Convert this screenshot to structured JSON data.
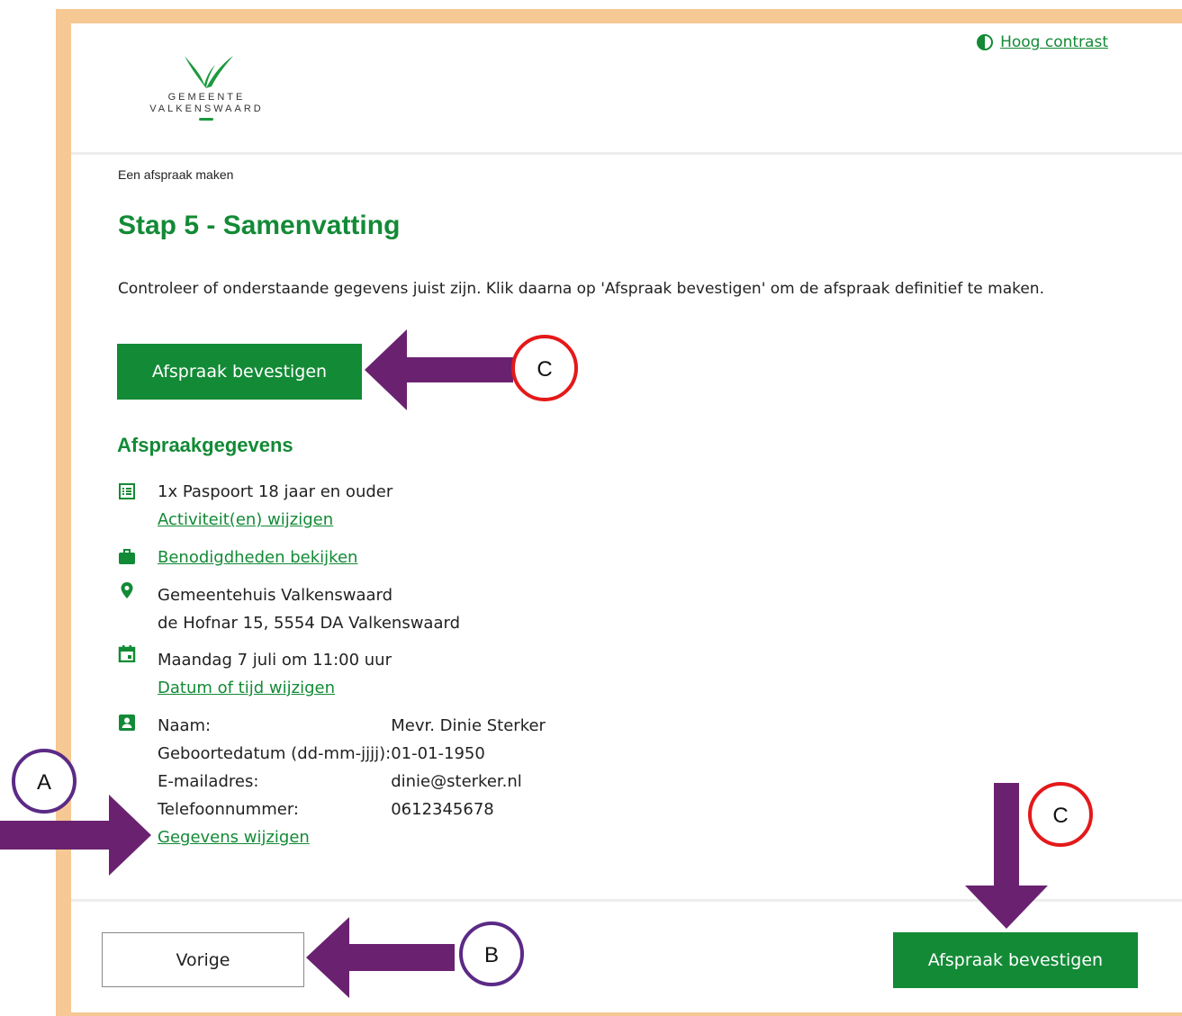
{
  "header": {
    "logo_line1": "GEMEENTE",
    "logo_line2": "VALKENSWAARD",
    "contrast_link": "Hoog contrast"
  },
  "breadcrumb": "Een afspraak maken",
  "title": "Stap 5 - Samenvatting",
  "intro": "Controleer of onderstaande gegevens juist zijn. Klik daarna op 'Afspraak bevestigen' om de afspraak definitief te maken.",
  "confirm_label": "Afspraak bevestigen",
  "section_title": "Afspraakgegevens",
  "activity": {
    "text": "1x Paspoort 18 jaar en ouder",
    "link": "Activiteit(en) wijzigen"
  },
  "requirements_link": "Benodigdheden bekijken",
  "location": {
    "name": "Gemeentehuis Valkenswaard",
    "address": "de Hofnar 15, 5554 DA Valkenswaard"
  },
  "datetime": {
    "text": "Maandag 7 juli om 11:00 uur",
    "link": "Datum of tijd wijzigen"
  },
  "person": {
    "rows": [
      {
        "label": "Naam:",
        "value": "Mevr. Dinie Sterker"
      },
      {
        "label": "Geboortedatum (dd-mm-jjjj):",
        "value": "01-01-1950"
      },
      {
        "label": "E-mailadres:",
        "value": "dinie@sterker.nl"
      },
      {
        "label": "Telefoonnummer:",
        "value": "0612345678"
      }
    ],
    "link": "Gegevens wijzigen"
  },
  "footer": {
    "prev_label": "Vorige",
    "confirm_label": "Afspraak bevestigen"
  },
  "annotations": {
    "a": "A",
    "b": "B",
    "c": "C",
    "arrow_color": "#6a2270",
    "circle_purple": "#5b2a86",
    "circle_red": "#e4191a"
  },
  "colors": {
    "brand_green": "#138a36",
    "frame": "#f6c894"
  }
}
